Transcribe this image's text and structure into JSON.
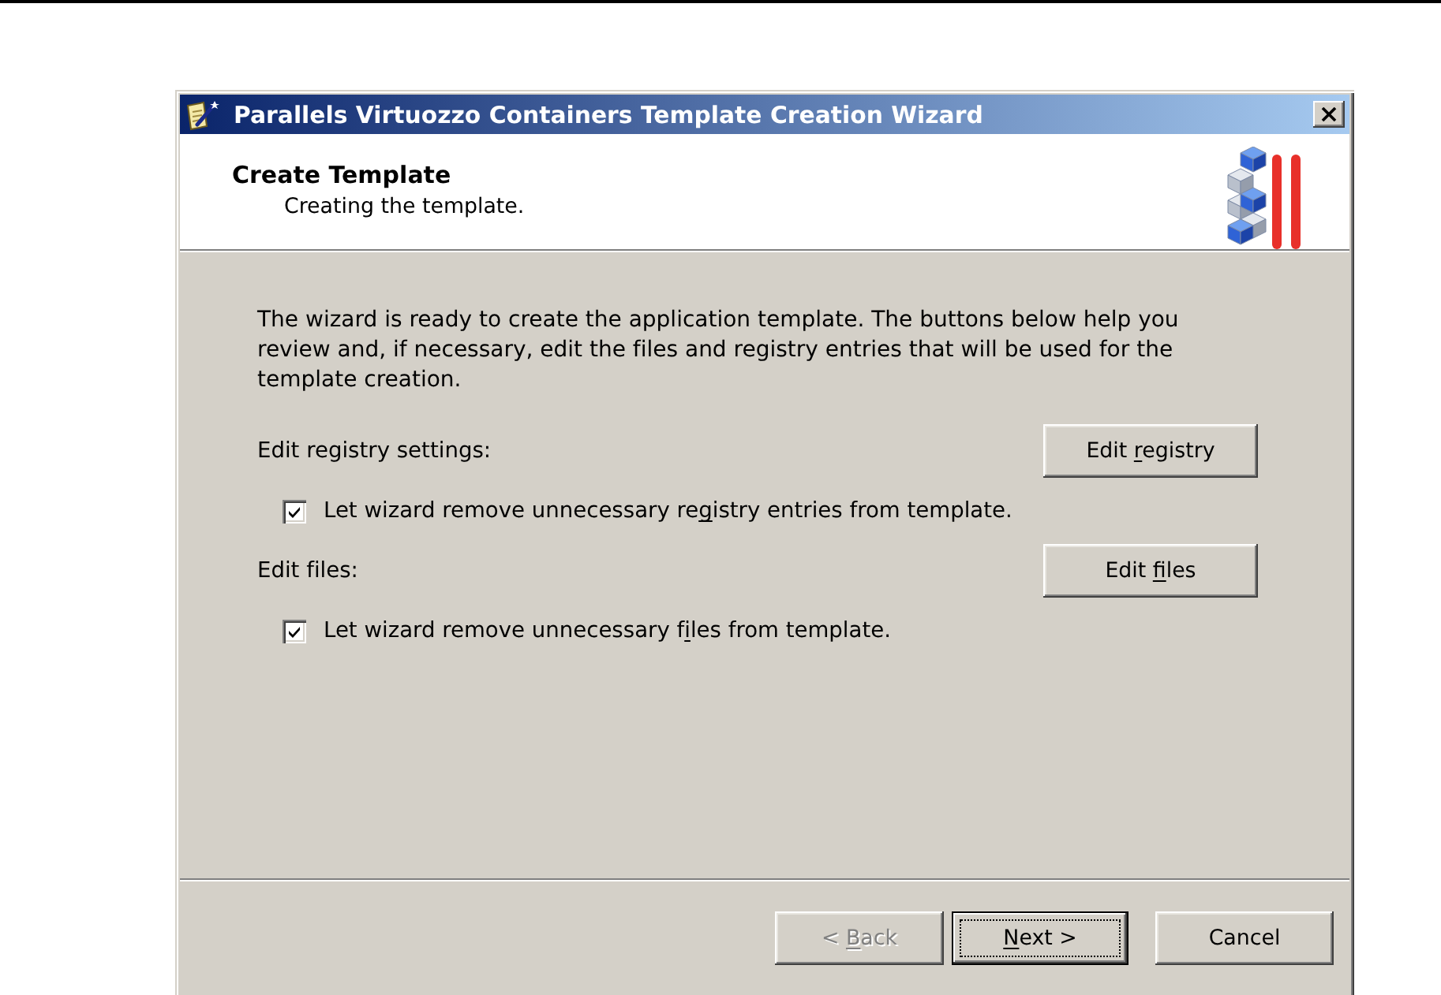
{
  "window": {
    "title": "Parallels Virtuozzo Containers Template Creation Wizard"
  },
  "header": {
    "title": "Create Template",
    "subtitle": "Creating the template."
  },
  "body": {
    "intro": "The wizard is ready to create the application template. The buttons below help you review and, if necessary, edit the files and registry entries that will be used for the template creation.",
    "sections": [
      {
        "label": "Edit registry settings:",
        "button": {
          "label_parts": [
            {
              "text": "Edit ",
              "underlined": false
            },
            {
              "text": "r",
              "underlined": true
            },
            {
              "text": "egistry",
              "underlined": false
            }
          ]
        },
        "option": {
          "checked": true,
          "label_parts": [
            {
              "text": "Let wizard remove unnecessary re",
              "underlined": false
            },
            {
              "text": "g",
              "underlined": true
            },
            {
              "text": "istry entries from template.",
              "underlined": false
            }
          ]
        }
      },
      {
        "label": "Edit files:",
        "button": {
          "label_parts": [
            {
              "text": "Edit ",
              "underlined": false
            },
            {
              "text": "f",
              "underlined": true
            },
            {
              "text": "iles",
              "underlined": false
            }
          ]
        },
        "option": {
          "checked": true,
          "label_parts": [
            {
              "text": "Let wizard remove unnecessary f",
              "underlined": false
            },
            {
              "text": "i",
              "underlined": true
            },
            {
              "text": "les from template.",
              "underlined": false
            }
          ]
        }
      }
    ]
  },
  "footer": {
    "buttons": [
      {
        "kind": "back",
        "disabled": true,
        "default": false,
        "label_parts": [
          {
            "text": "< ",
            "underlined": false
          },
          {
            "text": "B",
            "underlined": true
          },
          {
            "text": "ack",
            "underlined": false
          }
        ]
      },
      {
        "kind": "next",
        "disabled": false,
        "default": true,
        "label_parts": [
          {
            "text": "N",
            "underlined": true
          },
          {
            "text": "ext >",
            "underlined": false
          }
        ]
      },
      {
        "kind": "cancel",
        "disabled": false,
        "default": false,
        "label_parts": [
          {
            "text": "Cancel",
            "underlined": false
          }
        ]
      }
    ]
  }
}
